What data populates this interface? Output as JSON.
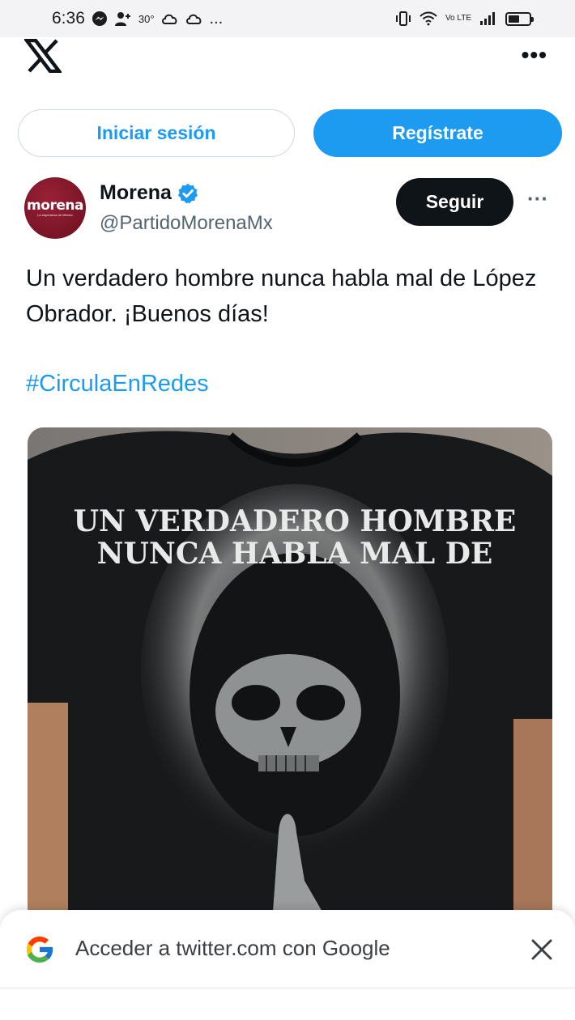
{
  "status_bar": {
    "time": "6:36",
    "temperature": "30°",
    "overflow": "...",
    "network_label": "Vo LTE",
    "battery_percent": 55
  },
  "top_bar": {
    "logo_icon": "x-logo-icon",
    "more_label": "•••"
  },
  "auth": {
    "login_label": "Iniciar sesión",
    "signup_label": "Regístrate",
    "accent_color": "#1d9bf0"
  },
  "tweet": {
    "author": {
      "name": "Morena",
      "handle": "@PartidoMorenaMx",
      "avatar_logo_text": "morena",
      "avatar_logo_subtext": "La esperanza de México",
      "verified": true
    },
    "follow_label": "Seguir",
    "more_label": "···",
    "text": "Un verdadero hombre nunca habla mal de López Obrador. ¡Buenos días!",
    "hashtag": "#CirculaEnRedes",
    "image": {
      "shirt_text_line1": "UN VERDADERO HOMBRE",
      "shirt_text_line2": "NUNCA HABLA MAL DE"
    }
  },
  "google_prompt": {
    "text": "Acceder a twitter.com con Google",
    "close_icon": "close-icon"
  }
}
